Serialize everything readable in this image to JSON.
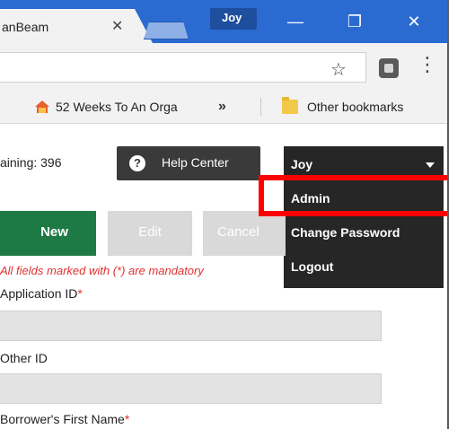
{
  "browser": {
    "tab_title": "anBeam",
    "tab_close": "✕",
    "profile_name": "Joy",
    "window_controls": {
      "minimize": "—",
      "restore": "❐",
      "close": "✕"
    },
    "address_value": "",
    "star_icon": "☆",
    "menu_icon": "⋮",
    "bookmarks": {
      "item1": "52 Weeks To An Orga",
      "overflow": "»",
      "other": "Other bookmarks"
    }
  },
  "header": {
    "remaining_text": "aining: 396",
    "help_icon": "?",
    "help_label": "Help Center",
    "user_name": "Joy"
  },
  "user_menu": {
    "items": [
      "Admin",
      "Change Password",
      "Logout"
    ]
  },
  "toolbar": {
    "new_label": "New",
    "edit_label": "Edit",
    "cancel_label": "Cancel"
  },
  "form": {
    "mandatory_note": "All fields marked with (*) are mandatory",
    "required_marker": "*",
    "fields": [
      {
        "label": "Application ID",
        "required": true,
        "value": ""
      },
      {
        "label": "Other ID",
        "required": false,
        "value": ""
      },
      {
        "label": "Borrower's First Name",
        "required": true,
        "value": ""
      }
    ]
  },
  "colors": {
    "titlebar": "#2b6ad1",
    "new_button": "#1e7a45",
    "dropdown": "#262626",
    "highlight": "#ff0000",
    "required": "#e03030"
  }
}
